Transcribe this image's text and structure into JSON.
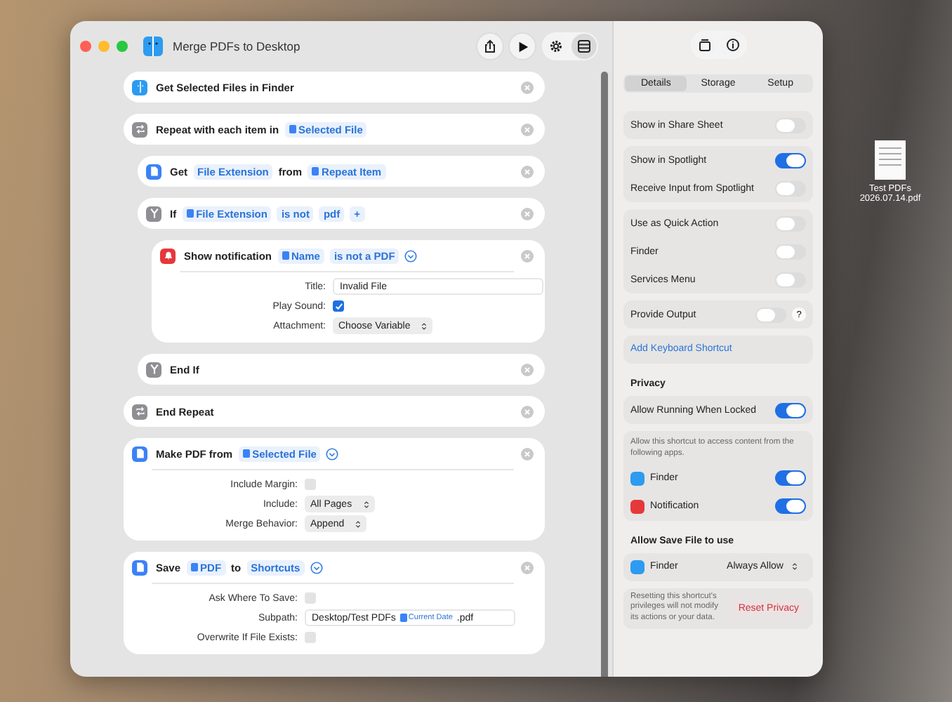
{
  "window": {
    "title": "Merge PDFs to Desktop"
  },
  "actions": [
    {
      "kind": "finder",
      "expand": false,
      "header": [
        {
          "kind": "text",
          "text": "Get Selected Files in Finder"
        }
      ]
    },
    {
      "kind": "repeat",
      "expand": false,
      "header": [
        {
          "kind": "text",
          "text": "Repeat with each item in"
        },
        {
          "kind": "var",
          "text": "Selected File"
        }
      ],
      "children": [
        {
          "kind": "file",
          "expand": false,
          "header": [
            {
              "kind": "text",
              "text": "Get"
            },
            {
              "kind": "token",
              "text": "File Extension"
            },
            {
              "kind": "text",
              "text": "from"
            },
            {
              "kind": "var",
              "text": "Repeat Item"
            }
          ]
        },
        {
          "kind": "if",
          "expand": false,
          "header": [
            {
              "kind": "text",
              "text": "If"
            },
            {
              "kind": "var",
              "text": "File Extension"
            },
            {
              "kind": "token",
              "text": "is not"
            },
            {
              "kind": "token",
              "text": "pdf"
            },
            {
              "kind": "token",
              "text": "+"
            }
          ],
          "children": [
            {
              "kind": "notification",
              "expand": true,
              "header": [
                {
                  "kind": "text",
                  "text": "Show notification"
                },
                {
                  "kind": "var",
                  "text": "Name"
                },
                {
                  "kind": "token",
                  "text": "is not a PDF"
                }
              ],
              "params": [
                {
                  "kind": "text",
                  "label": "Title:",
                  "value": "Invalid File"
                },
                {
                  "kind": "checkbox",
                  "label": "Play Sound:",
                  "checked": true
                },
                {
                  "kind": "popup",
                  "label": "Attachment:",
                  "value": "Choose Variable"
                }
              ]
            }
          ]
        },
        {
          "kind": "if",
          "expand": false,
          "header": [
            {
              "kind": "text",
              "text": "End If"
            }
          ]
        }
      ]
    },
    {
      "kind": "repeat",
      "expand": false,
      "header": [
        {
          "kind": "text",
          "text": "End Repeat"
        }
      ]
    },
    {
      "kind": "pdf",
      "expand": true,
      "header": [
        {
          "kind": "text",
          "text": "Make PDF from"
        },
        {
          "kind": "var",
          "text": "Selected File"
        }
      ],
      "params": [
        {
          "kind": "checkbox",
          "label": "Include Margin:",
          "checked": false
        },
        {
          "kind": "popup",
          "label": "Include:",
          "value": "All Pages"
        },
        {
          "kind": "popup",
          "label": "Merge Behavior:",
          "value": "Append"
        }
      ]
    },
    {
      "kind": "file",
      "expand": true,
      "header": [
        {
          "kind": "text",
          "text": "Save"
        },
        {
          "kind": "var",
          "text": "PDF"
        },
        {
          "kind": "text",
          "text": "to"
        },
        {
          "kind": "token",
          "text": "Shortcuts"
        }
      ],
      "params": [
        {
          "kind": "checkbox",
          "label": "Ask Where To Save:",
          "checked": false
        },
        {
          "kind": "rich",
          "label": "Subpath:",
          "parts": [
            {
              "kind": "text",
              "text": "Desktop/Test PDFs"
            },
            {
              "kind": "var",
              "text": "Current Date"
            },
            {
              "kind": "text",
              "text": ".pdf"
            }
          ]
        },
        {
          "kind": "checkbox",
          "label": "Overwrite If File Exists:",
          "checked": false
        }
      ]
    }
  ],
  "inspector": {
    "tabs": [
      {
        "label": "Details",
        "selected": true
      },
      {
        "label": "Storage",
        "selected": false
      },
      {
        "label": "Setup",
        "selected": false
      }
    ],
    "sections": [
      {
        "kind": "group",
        "rows": [
          {
            "kind": "plain",
            "label": "Show in Share Sheet",
            "on": false
          }
        ]
      },
      {
        "kind": "group",
        "rows": [
          {
            "kind": "plain",
            "label": "Show in Spotlight",
            "on": true
          },
          {
            "kind": "plain",
            "label": "Receive Input from Spotlight",
            "on": false
          }
        ]
      },
      {
        "kind": "group",
        "rows": [
          {
            "kind": "plain",
            "label": "Use as Quick Action",
            "on": false
          },
          {
            "kind": "plain",
            "label": "Finder",
            "on": false
          },
          {
            "kind": "plain",
            "label": "Services Menu",
            "on": false
          }
        ]
      },
      {
        "kind": "group",
        "rows": [
          {
            "kind": "plain",
            "label": "Provide Output",
            "on": false,
            "help": "?"
          }
        ]
      },
      {
        "kind": "link",
        "text": "Add Keyboard Shortcut"
      },
      {
        "kind": "heading",
        "text": "Privacy"
      },
      {
        "kind": "group",
        "rows": [
          {
            "kind": "plain",
            "label": "Allow Running When Locked",
            "on": true
          }
        ]
      },
      {
        "kind": "group",
        "note": "Allow this shortcut to access content from the following apps.",
        "rows": [
          {
            "kind": "finder",
            "label": "Finder",
            "on": true
          },
          {
            "kind": "notification",
            "label": "Notification",
            "on": true
          }
        ]
      },
      {
        "kind": "heading",
        "text": "Allow Save File to use"
      },
      {
        "kind": "popup_group",
        "label": "Finder",
        "value": "Always Allow"
      },
      {
        "kind": "reset",
        "note": "Resetting this shortcut's privileges will not modify its actions or your data.",
        "button": "Reset Privacy"
      }
    ]
  },
  "desktop_file": {
    "name": "Test PDFs 2026.07.14.pdf"
  }
}
